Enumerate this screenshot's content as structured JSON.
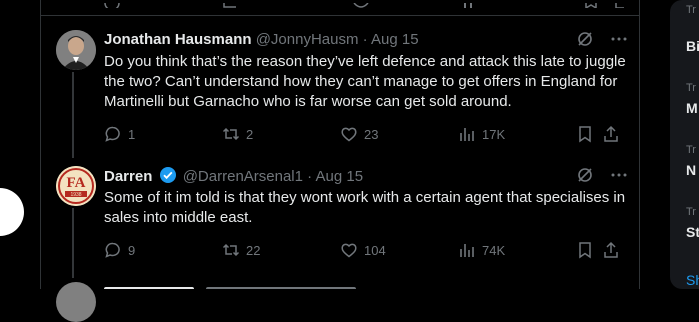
{
  "tweets": [
    {
      "name": "Jonathan Hausmann",
      "handle": "@JonnyHausm",
      "date": "Aug 15",
      "verified": false,
      "text": "Do you think that’s the reason they’ve left defence and attack this late to juggle the two? Can’t understand how they can’t manage to get offers in England for Martinelli but Garnacho who is far worse can get sold around.",
      "replies": "1",
      "reposts": "2",
      "likes": "23",
      "views": "17K"
    },
    {
      "name": "Darren",
      "handle": "@DarrenArsenal1",
      "date": "Aug 15",
      "verified": true,
      "avatar_text": "1938",
      "text": "Some of it im told is that they wont work with a certain agent that specialises in sales into middle east.",
      "replies": "9",
      "reposts": "22",
      "likes": "104",
      "views": "74K"
    }
  ],
  "sidebar": {
    "trends": [
      {
        "small": "Tr",
        "large": "Bi"
      },
      {
        "small": "Tr",
        "large": "M"
      },
      {
        "small": "Tr",
        "large": "N"
      },
      {
        "small": "Tr",
        "large": "St"
      }
    ],
    "show_more": "Sh"
  },
  "colors": {
    "background": "#000000",
    "text": "#e7e9ea",
    "muted": "#71767b",
    "border": "#2f3336",
    "accent": "#1d9bf0"
  },
  "icons": [
    "reply-icon",
    "repost-icon",
    "like-icon",
    "views-icon",
    "bookmark-icon",
    "share-icon",
    "grok-icon",
    "more-icon",
    "verified-icon"
  ]
}
